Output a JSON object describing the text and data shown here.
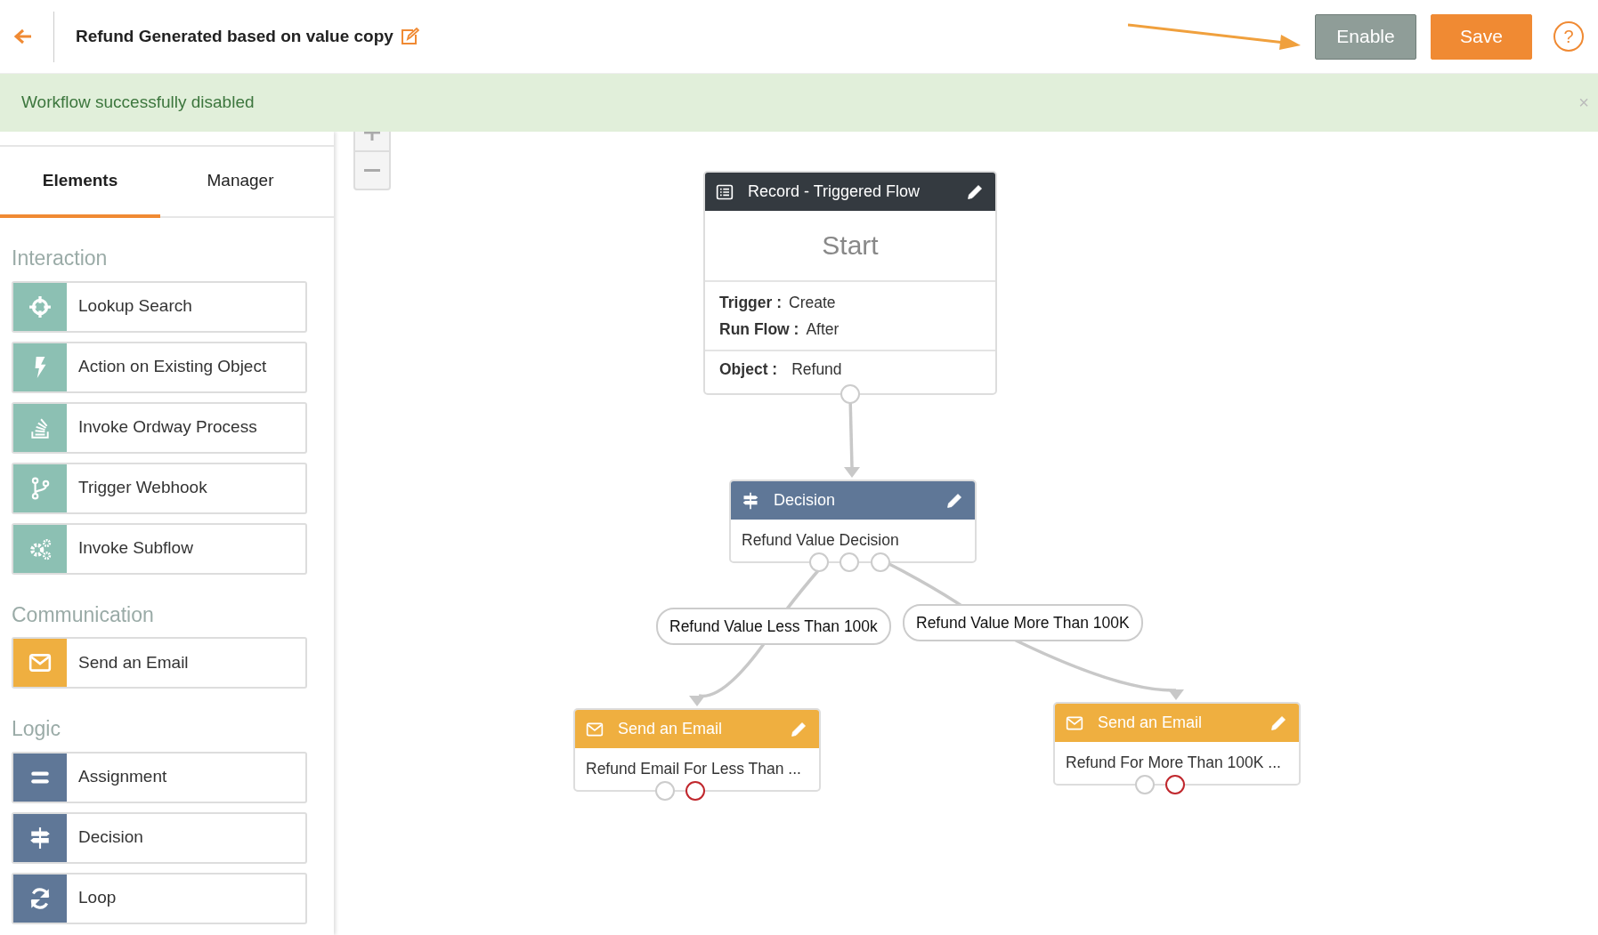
{
  "header": {
    "title": "Refund Generated based on value copy",
    "buttons": [
      {
        "label": "Enable",
        "kind": "secondary"
      },
      {
        "label": "Save",
        "kind": "primary"
      }
    ],
    "help": "?"
  },
  "alert": {
    "message": "Workflow successfully disabled",
    "close": "×"
  },
  "sidebar": {
    "tabs": [
      {
        "label": "Elements",
        "selected": true
      },
      {
        "label": "Manager",
        "selected": false
      }
    ],
    "sections": [
      {
        "title": "Interaction",
        "items": [
          {
            "label": "Lookup Search",
            "color": "#8cc0b3"
          },
          {
            "label": "Action on Existing Object",
            "color": "#8cc0b3"
          },
          {
            "label": "Invoke Ordway Process",
            "color": "#8cc0b3"
          },
          {
            "label": "Trigger Webhook",
            "color": "#8cc0b3"
          },
          {
            "label": "Invoke Subflow",
            "color": "#8cc0b3"
          }
        ]
      },
      {
        "title": "Communication",
        "items": [
          {
            "label": "Send an Email",
            "color": "#efaf40"
          }
        ]
      },
      {
        "title": "Logic",
        "items": [
          {
            "label": "Assignment",
            "color": "#5f7797"
          },
          {
            "label": "Decision",
            "color": "#5f7797"
          },
          {
            "label": "Loop",
            "color": "#5f7797"
          }
        ]
      }
    ]
  },
  "canvas": {
    "nodes": [
      {
        "kind": "start",
        "title": "Record - Triggered Flow",
        "heading": "Start",
        "fields": [
          {
            "label": "Trigger :",
            "value": "Create"
          },
          {
            "label": "Run Flow :",
            "value": "After"
          }
        ],
        "object": {
          "label": "Object :",
          "value": "Refund"
        }
      },
      {
        "kind": "decision",
        "title": "Decision",
        "body": "Refund Value Decision"
      },
      {
        "kind": "email",
        "title": "Send an Email",
        "body": "Refund Email For Less Than ..."
      },
      {
        "kind": "email",
        "title": "Send an Email",
        "body": "Refund For More Than 100K ..."
      }
    ],
    "edge_labels": [
      "Refund Value Less Than 100k",
      "Refund Value More Than 100K"
    ]
  }
}
